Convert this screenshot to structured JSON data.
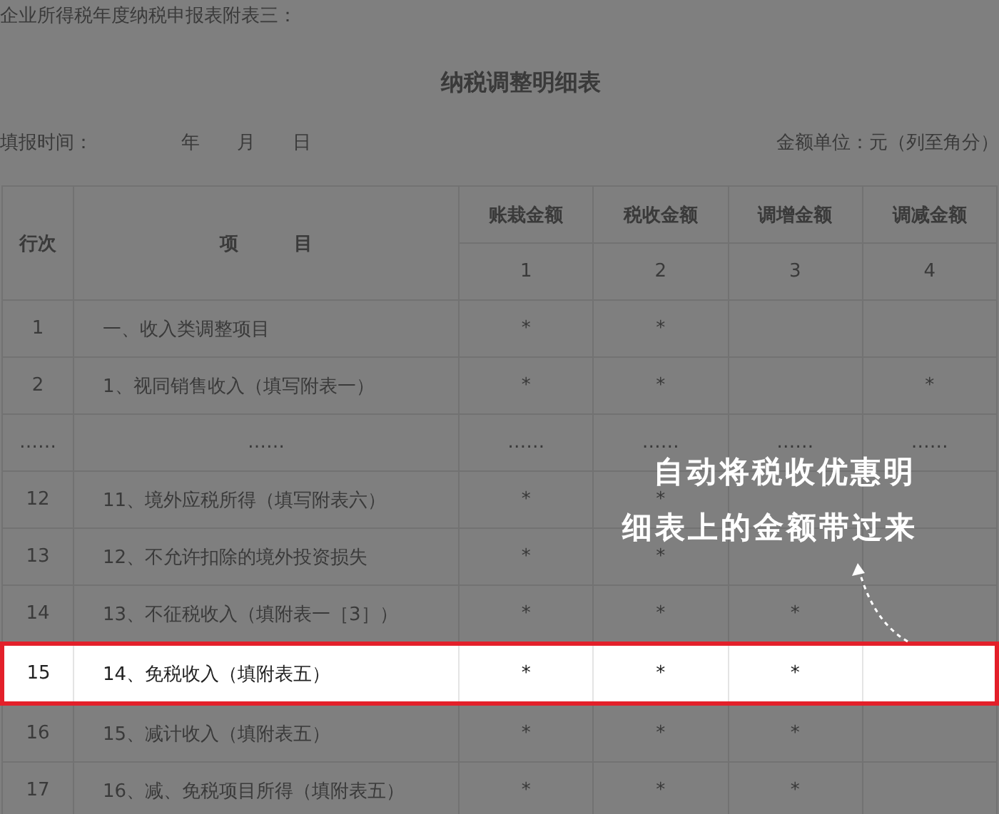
{
  "caption": "企业所得税年度纳税申报表附表三：",
  "title": "纳税调整明细表",
  "fill_time": {
    "label": "填报时间：",
    "parts": [
      "年",
      "月",
      "日"
    ]
  },
  "unit": "金额单位：元（列至角分）",
  "table": {
    "columns": [
      {
        "label": "行次"
      },
      {
        "label": "项　　　目"
      },
      {
        "label": "账栽金额",
        "number": "1"
      },
      {
        "label": "税收金额",
        "number": "2"
      },
      {
        "label": "调增金额",
        "number": "3"
      },
      {
        "label": "调减金额",
        "number": "4"
      }
    ],
    "rows": [
      {
        "selected": false,
        "cells": [
          "1",
          "一、收入类调整项目",
          "*",
          "*",
          "",
          ""
        ]
      },
      {
        "selected": false,
        "cells": [
          "2",
          "1、视同销售收入（填写附表一）",
          "*",
          "*",
          "",
          "*"
        ]
      },
      {
        "selected": false,
        "cells": [
          "……",
          "……",
          "……",
          "……",
          "……",
          "……"
        ]
      },
      {
        "selected": false,
        "cells": [
          "12",
          "11、境外应税所得（填写附表六）",
          "*",
          "*",
          "",
          ""
        ]
      },
      {
        "selected": false,
        "cells": [
          "13",
          "12、不允许扣除的境外投资损失",
          "*",
          "*",
          "",
          ""
        ]
      },
      {
        "selected": false,
        "cells": [
          "14",
          "13、不征税收入（填附表一［3］）",
          "*",
          "*",
          "*",
          ""
        ]
      },
      {
        "selected": true,
        "cells": [
          "15",
          "14、免税收入（填附表五）",
          "*",
          "*",
          "*",
          ""
        ]
      },
      {
        "selected": false,
        "cells": [
          "16",
          "15、减计收入（填附表五）",
          "*",
          "*",
          "*",
          ""
        ]
      },
      {
        "selected": false,
        "cells": [
          "17",
          "16、减、免税项目所得（填附表五）",
          "*",
          "*",
          "*",
          ""
        ]
      }
    ]
  },
  "annotation": {
    "lines": [
      "自动将税收优惠明",
      "细表上的金额带过来"
    ]
  }
}
